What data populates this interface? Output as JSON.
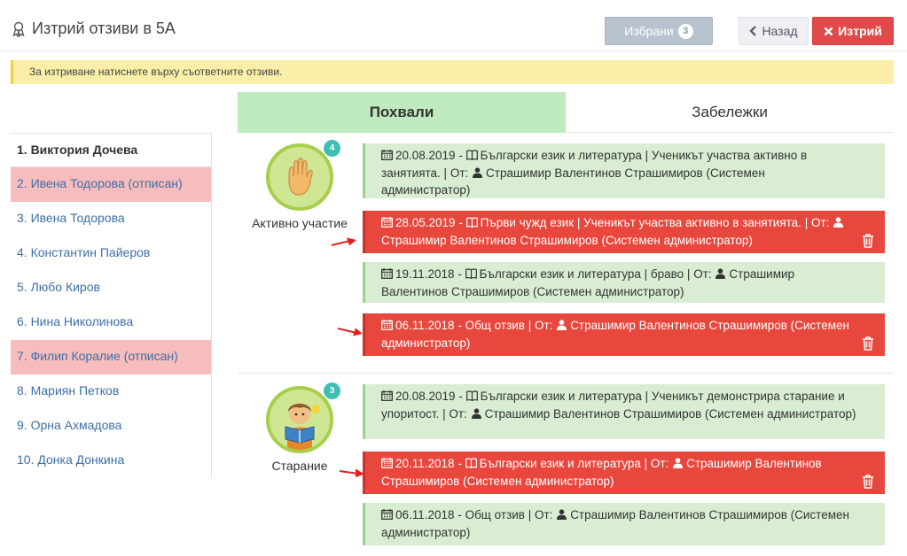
{
  "header": {
    "title": "Изтрий отзиви в 5А",
    "selected_label": "Избрани",
    "selected_count": "3",
    "back_label": "Назад",
    "delete_label": "Изтрий"
  },
  "notice": "За изтриване натиснете върху съответните отзиви.",
  "students": [
    {
      "label": "1. Виктория Дочева"
    },
    {
      "label": "2. Ивена Тодорова (отписан)"
    },
    {
      "label": "3. Ивена Тодорова"
    },
    {
      "label": "4. Константин Пайеров"
    },
    {
      "label": "5. Любо Киров"
    },
    {
      "label": "6. Нина Николинова"
    },
    {
      "label": "7. Филип Коралие (отписан)"
    },
    {
      "label": "8. Мариян Петков"
    },
    {
      "label": "9. Орна Ахмадова"
    },
    {
      "label": "10. Донка Донкина"
    }
  ],
  "tabs": {
    "praise": "Похвали",
    "remarks": "Забележки"
  },
  "groups": [
    {
      "label": "Активно участие",
      "count": "4",
      "items": [
        {
          "date": "20.08.2019",
          "subject": "Български език и литература",
          "text": "Ученикът участва активно в занятията.",
          "from_label": "От:",
          "author": "Страшимир Валентинов Страшимиров (Системен администратор)"
        },
        {
          "date": "28.05.2019",
          "subject": "Първи чужд език",
          "text": "Ученикът участва активно в занятията.",
          "from_label": "От:",
          "author": "Страшимир Валентинов Страшимиров (Системен администратор)"
        },
        {
          "date": "19.11.2018",
          "subject": "Български език и литература",
          "text": "браво",
          "from_label": "От:",
          "author": "Страшимир Валентинов Страшимиров (Системен администратор)"
        },
        {
          "date": "06.11.2018",
          "general": "Общ отзив",
          "from_label": "От:",
          "author": "Страшимир Валентинов Страшимиров (Системен администратор)"
        }
      ]
    },
    {
      "label": "Старание",
      "count": "3",
      "items": [
        {
          "date": "20.08.2019",
          "subject": "Български език и литература",
          "text": "Ученикът демонстрира старание и упоритост.",
          "from_label": "От:",
          "author": "Страшимир Валентинов Страшимиров (Системен администратор)"
        },
        {
          "date": "20.11.2018",
          "subject": "Български език и литература",
          "from_label": "От:",
          "author": "Страшимир Валентинов Страшимиров (Системен администратор)"
        },
        {
          "date": "06.11.2018",
          "general": "Общ отзив",
          "from_label": "От:",
          "author": "Страшимир Валентинов Страшимиров (Системен администратор)"
        }
      ]
    }
  ],
  "colors": {
    "delete": "#e04a4a",
    "marked": "#e8473d",
    "normal": "#d9edd3",
    "tab_active": "#bfeabd",
    "notice": "#fbeea9"
  },
  "icons": [
    "award-icon",
    "chevron-left-icon",
    "close-icon",
    "calendar-icon",
    "book-icon",
    "user-icon",
    "trash-icon",
    "arrow-right-icon",
    "hand-icon",
    "reading-boy-icon"
  ]
}
